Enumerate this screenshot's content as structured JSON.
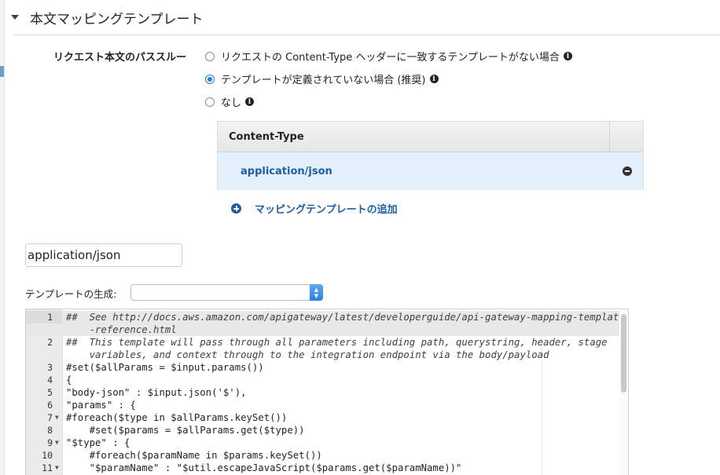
{
  "section": {
    "title": "本文マッピングテンプレート"
  },
  "passthrough": {
    "label": "リクエスト本文のパススルー",
    "options": [
      {
        "label": "リクエストの Content-Type ヘッダーに一致するテンプレートがない場合",
        "selected": false
      },
      {
        "label": "テンプレートが定義されていない場合 (推奨)",
        "selected": true
      },
      {
        "label": "なし",
        "selected": false
      }
    ]
  },
  "content_type_table": {
    "header": "Content-Type",
    "rows": [
      {
        "value": "application/json"
      }
    ],
    "add_label": "マッピングテンプレートの追加"
  },
  "content_type_input": {
    "value": "application/json"
  },
  "template_generator": {
    "label": "テンプレートの生成:",
    "selected": ""
  },
  "editor": {
    "lines": [
      {
        "n": "1",
        "fold": false,
        "text": "##  See http://docs.aws.amazon.com/apigateway/latest/developerguide/api-gateway-mapping-template",
        "kind": "comment"
      },
      {
        "n": "",
        "fold": false,
        "text": "    -reference.html",
        "kind": "comment"
      },
      {
        "n": "2",
        "fold": false,
        "text": "##  This template will pass through all parameters including path, querystring, header, stage",
        "kind": "comment"
      },
      {
        "n": "",
        "fold": false,
        "text": "    variables, and context through to the integration endpoint via the body/payload",
        "kind": "comment"
      },
      {
        "n": "3",
        "fold": false,
        "text": "#set($allParams = $input.params())",
        "kind": "code"
      },
      {
        "n": "4",
        "fold": false,
        "text": "{",
        "kind": "code"
      },
      {
        "n": "5",
        "fold": false,
        "text": "\"body-json\" : $input.json('$'),",
        "kind": "code"
      },
      {
        "n": "6",
        "fold": false,
        "text": "\"params\" : {",
        "kind": "code"
      },
      {
        "n": "7",
        "fold": true,
        "text": "#foreach($type in $allParams.keySet())",
        "kind": "code"
      },
      {
        "n": "8",
        "fold": false,
        "text": "    #set($params = $allParams.get($type))",
        "kind": "code"
      },
      {
        "n": "9",
        "fold": true,
        "text": "\"$type\" : {",
        "kind": "code"
      },
      {
        "n": "10",
        "fold": false,
        "text": "    #foreach($paramName in $params.keySet())",
        "kind": "code"
      },
      {
        "n": "11",
        "fold": true,
        "text": "    \"$paramName\" : \"$util.escapeJavaScript($params.get($paramName))\"",
        "kind": "code"
      }
    ]
  }
}
